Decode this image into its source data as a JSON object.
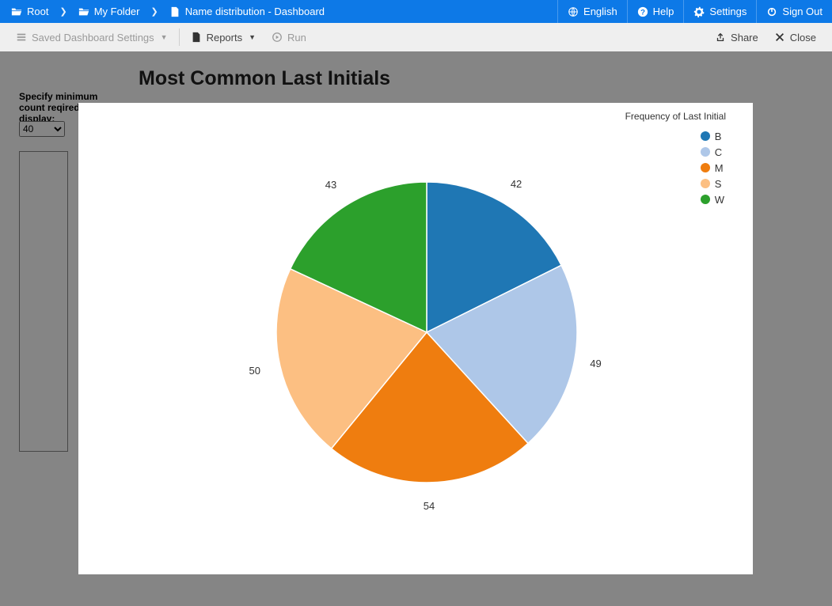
{
  "topbar": {
    "breadcrumb": [
      {
        "label": "Root"
      },
      {
        "label": "My Folder"
      },
      {
        "label": "Name distribution - Dashboard"
      }
    ],
    "right": {
      "english": "English",
      "help": "Help",
      "settings": "Settings",
      "signout": "Sign Out"
    }
  },
  "toolbar": {
    "saved_settings": "Saved Dashboard Settings",
    "reports": "Reports",
    "run": "Run",
    "share": "Share",
    "close": "Close"
  },
  "page": {
    "title": "Most Common Last Initials",
    "filter_label": "Specify minimum count reqired to display:",
    "filter_value": "40"
  },
  "chart_data": {
    "type": "pie",
    "title": "Frequency of Last Initial",
    "series": [
      {
        "name": "B",
        "value": 42,
        "color": "#1f77b4"
      },
      {
        "name": "C",
        "value": 49,
        "color": "#aec7e8"
      },
      {
        "name": "M",
        "value": 54,
        "color": "#ef7d0f"
      },
      {
        "name": "S",
        "value": 50,
        "color": "#fcbf82"
      },
      {
        "name": "W",
        "value": 43,
        "color": "#2ca02c"
      }
    ]
  }
}
